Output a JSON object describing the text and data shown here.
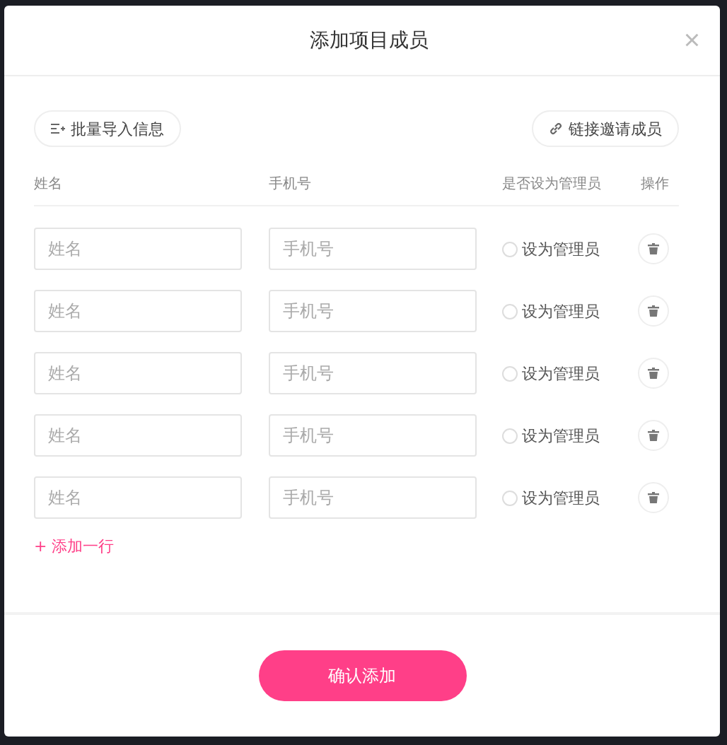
{
  "dialog": {
    "title": "添加项目成员",
    "close": "×"
  },
  "toolbar": {
    "import_button": "批量导入信息",
    "invite_button": "链接邀请成员"
  },
  "table": {
    "columns": [
      "姓名",
      "手机号",
      "是否设为管理员",
      "操作"
    ],
    "rows": [
      {
        "name_placeholder": "姓名",
        "phone_placeholder": "手机号",
        "admin_label": "设为管理员",
        "admin": false
      },
      {
        "name_placeholder": "姓名",
        "phone_placeholder": "手机号",
        "admin_label": "设为管理员",
        "admin": false
      },
      {
        "name_placeholder": "姓名",
        "phone_placeholder": "手机号",
        "admin_label": "设为管理员",
        "admin": false
      },
      {
        "name_placeholder": "姓名",
        "phone_placeholder": "手机号",
        "admin_label": "设为管理员",
        "admin": false
      },
      {
        "name_placeholder": "姓名",
        "phone_placeholder": "手机号",
        "admin_label": "设为管理员",
        "admin": false
      }
    ]
  },
  "add_row": "+ 添加一行",
  "confirm_button": "确认添加"
}
